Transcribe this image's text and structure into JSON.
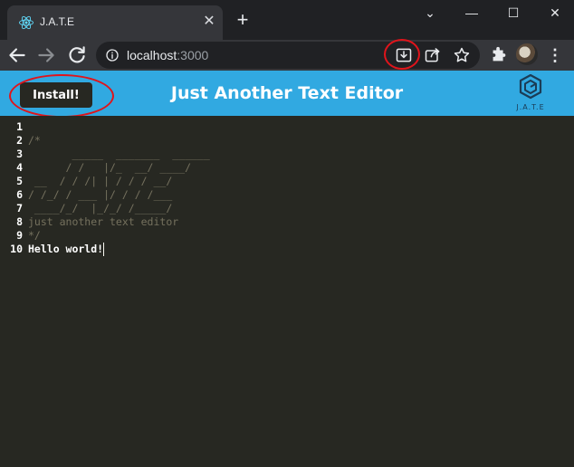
{
  "browser": {
    "tab_title": "J.A.T.E",
    "tab_close_glyph": "✕",
    "new_tab_glyph": "+",
    "window_controls": [
      "⌄",
      "—",
      "☐",
      "✕"
    ],
    "url_host": "localhost",
    "url_port": ":3000",
    "icons": {
      "tab_favicon": "react-logo-icon",
      "back": "arrow-left-icon",
      "forward": "arrow-right-icon",
      "reload": "reload-icon",
      "site_info": "info-icon",
      "install_app": "install-app-icon",
      "share": "share-icon",
      "bookmark": "star-icon",
      "extensions": "puzzle-icon",
      "menu": "kebab-menu-icon"
    },
    "menu_glyph": "⋮"
  },
  "app": {
    "install_label": "Install!",
    "title": "Just Another Text Editor",
    "logo_text": "J.A.T.E",
    "header_color": "#31a9e1"
  },
  "editor": {
    "line_numbers": [
      "1",
      "2",
      "3",
      "4",
      "5",
      "6",
      "7",
      "8",
      "9",
      "10"
    ],
    "lines": [
      "",
      "/*",
      "       _____  _______  ______",
      "      / /   |/_  __/ ____/",
      " __  / / /| | / / / __/",
      "/ /_/ / ___ |/ / / /___",
      " ____/_/  |_/_/ /_____/",
      "just another text editor",
      "*/",
      "Hello world!"
    ]
  },
  "annotation_color": "#e0141b"
}
